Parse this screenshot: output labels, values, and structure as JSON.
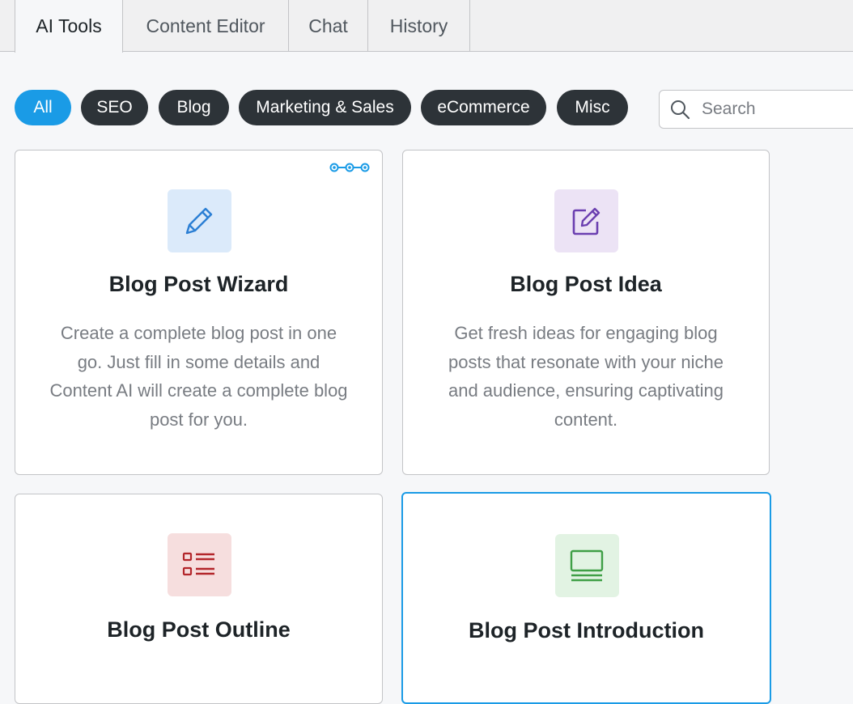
{
  "tabs": [
    {
      "label": "AI Tools",
      "active": true
    },
    {
      "label": "Content Editor",
      "active": false
    },
    {
      "label": "Chat",
      "active": false
    },
    {
      "label": "History",
      "active": false
    }
  ],
  "filters": [
    {
      "label": "All",
      "active": true
    },
    {
      "label": "SEO",
      "active": false
    },
    {
      "label": "Blog",
      "active": false
    },
    {
      "label": "Marketing & Sales",
      "active": false
    },
    {
      "label": "eCommerce",
      "active": false
    },
    {
      "label": "Misc",
      "active": false
    }
  ],
  "search": {
    "placeholder": "Search",
    "value": "",
    "icon": "search-icon"
  },
  "colors": {
    "accent": "#1a9be6",
    "pill_dark": "#2d3338",
    "wizard_bg": "#dbeafa",
    "wizard_fg": "#2b7fd4",
    "idea_bg": "#ece3f5",
    "idea_fg": "#6b3fb0",
    "outline_bg": "#f6dede",
    "outline_fg": "#b3262b",
    "intro_bg": "#e2f3e3",
    "intro_fg": "#3f9f46"
  },
  "cards": [
    {
      "title": "Blog Post Wizard",
      "description": "Create a complete blog post in one go. Just fill in some details and Content AI will create a complete blog post for you.",
      "icon": "pencil-icon",
      "badge_icon": "multi-step-icon"
    },
    {
      "title": "Blog Post Idea",
      "description": "Get fresh ideas for engaging blog posts that resonate with your niche and audience, ensuring captivating content.",
      "icon": "edit-square-icon"
    },
    {
      "title": "Blog Post Outline",
      "description": "",
      "icon": "list-icon"
    },
    {
      "title": "Blog Post Introduction",
      "description": "",
      "icon": "monitor-icon"
    }
  ]
}
